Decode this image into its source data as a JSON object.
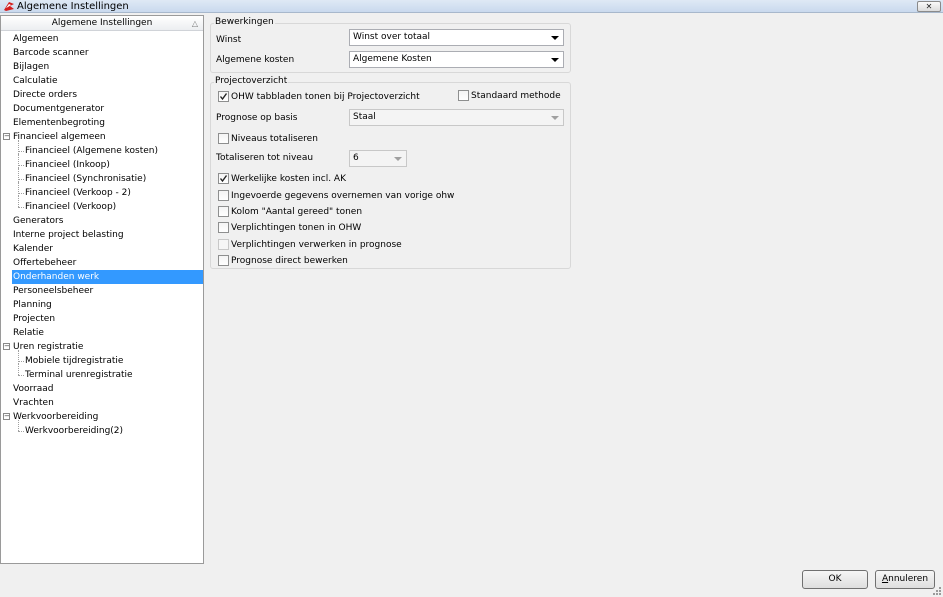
{
  "window": {
    "title": "Algemene Instellingen",
    "close_glyph": "✕"
  },
  "tree": {
    "header": "Algemene Instellingen",
    "sort_glyph": "△",
    "items": [
      {
        "label": "Algemeen",
        "level": 0
      },
      {
        "label": "Barcode scanner",
        "level": 0
      },
      {
        "label": "Bijlagen",
        "level": 0
      },
      {
        "label": "Calculatie",
        "level": 0
      },
      {
        "label": "Directe orders",
        "level": 0
      },
      {
        "label": "Documentgenerator",
        "level": 0
      },
      {
        "label": "Elementenbegroting",
        "level": 0
      },
      {
        "label": "Financieel algemeen",
        "level": 0,
        "expanded": true
      },
      {
        "label": "Financieel (Algemene kosten)",
        "level": 1
      },
      {
        "label": "Financieel (Inkoop)",
        "level": 1
      },
      {
        "label": "Financieel (Synchronisatie)",
        "level": 1
      },
      {
        "label": "Financieel (Verkoop - 2)",
        "level": 1
      },
      {
        "label": "Financieel (Verkoop)",
        "level": 1
      },
      {
        "label": "Generators",
        "level": 0
      },
      {
        "label": "Interne project belasting",
        "level": 0
      },
      {
        "label": "Kalender",
        "level": 0
      },
      {
        "label": "Offertebeheer",
        "level": 0
      },
      {
        "label": "Onderhanden werk",
        "level": 0,
        "selected": true
      },
      {
        "label": "Personeelsbeheer",
        "level": 0
      },
      {
        "label": "Planning",
        "level": 0
      },
      {
        "label": "Projecten",
        "level": 0
      },
      {
        "label": "Relatie",
        "level": 0
      },
      {
        "label": "Uren registratie",
        "level": 0,
        "expanded": true
      },
      {
        "label": "Mobiele tijdregistratie",
        "level": 1
      },
      {
        "label": "Terminal urenregistratie",
        "level": 1
      },
      {
        "label": "Voorraad",
        "level": 0
      },
      {
        "label": "Vrachten",
        "level": 0
      },
      {
        "label": "Werkvoorbereiding",
        "level": 0,
        "expanded": true
      },
      {
        "label": "Werkvoorbereiding(2)",
        "level": 1
      }
    ]
  },
  "bewerkingen": {
    "title": "Bewerkingen",
    "winst_label": "Winst",
    "winst_value": "Winst over totaal",
    "kosten_label": "Algemene kosten",
    "kosten_value": "Algemene Kosten"
  },
  "projectoverzicht": {
    "title": "Projectoverzicht",
    "ohw_tabs_label": "OHW tabbladen tonen bij Projectoverzicht",
    "ohw_tabs_checked": true,
    "standaard_label": "Standaard methode",
    "standaard_checked": false,
    "prognose_label": "Prognose op basis",
    "prognose_value": "Staal",
    "niveaus_label": "Niveaus totaliseren",
    "niveaus_checked": false,
    "totaliseren_label": "Totaliseren tot niveau",
    "totaliseren_value": "6",
    "options": [
      {
        "label": "Werkelijke kosten incl. AK",
        "checked": true,
        "disabled": false
      },
      {
        "label": "Ingevoerde gegevens overnemen van vorige ohw",
        "checked": false,
        "disabled": false
      },
      {
        "label": "Kolom \"Aantal gereed\" tonen",
        "checked": false,
        "disabled": false
      },
      {
        "label": "Verplichtingen tonen in OHW",
        "checked": false,
        "disabled": false
      },
      {
        "label": "Verplichtingen verwerken in prognose",
        "checked": false,
        "disabled": true
      },
      {
        "label": "Prognose direct bewerken",
        "checked": false,
        "disabled": false
      }
    ]
  },
  "buttons": {
    "ok": "OK",
    "cancel_prefix": "A",
    "cancel_rest": "nnuleren"
  },
  "colors": {
    "selection": "#3399ff",
    "brand_icon": "#d42020"
  }
}
